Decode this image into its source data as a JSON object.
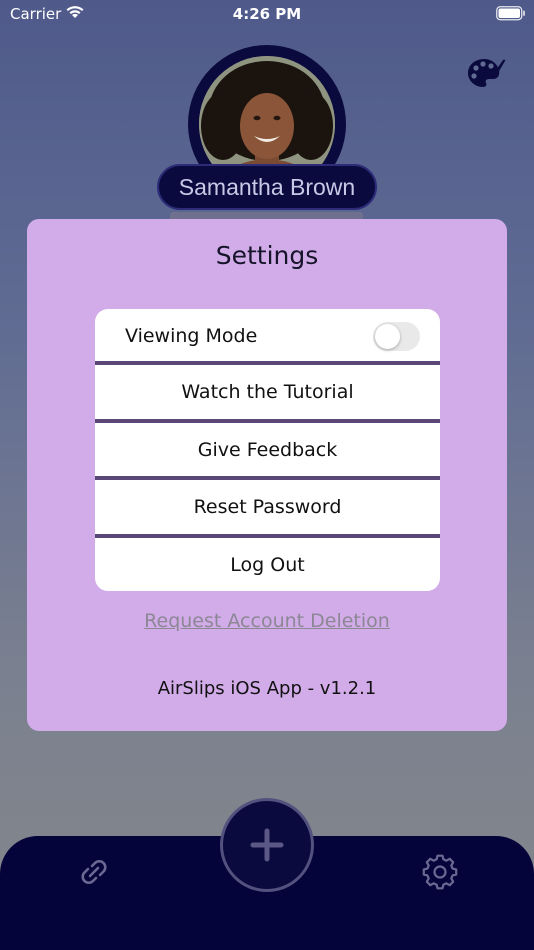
{
  "status_bar": {
    "carrier": "Carrier",
    "time": "4:26 PM"
  },
  "profile": {
    "name": "Samantha Brown"
  },
  "settings": {
    "title": "Settings",
    "viewing_mode_label": "Viewing Mode",
    "viewing_mode_on": false,
    "watch_tutorial": "Watch the Tutorial",
    "give_feedback": "Give Feedback",
    "reset_password": "Reset Password",
    "log_out": "Log Out",
    "request_deletion": "Request Account Deletion",
    "version": "AirSlips iOS App - v1.2.1"
  },
  "colors": {
    "card": "#d2ace9",
    "navy": "#05043a",
    "separator": "#5a4777",
    "plus": "#5b5885"
  },
  "icons": {
    "palette": "palette-icon",
    "link": "link-icon",
    "add": "plus-icon",
    "settings": "gear-icon"
  }
}
